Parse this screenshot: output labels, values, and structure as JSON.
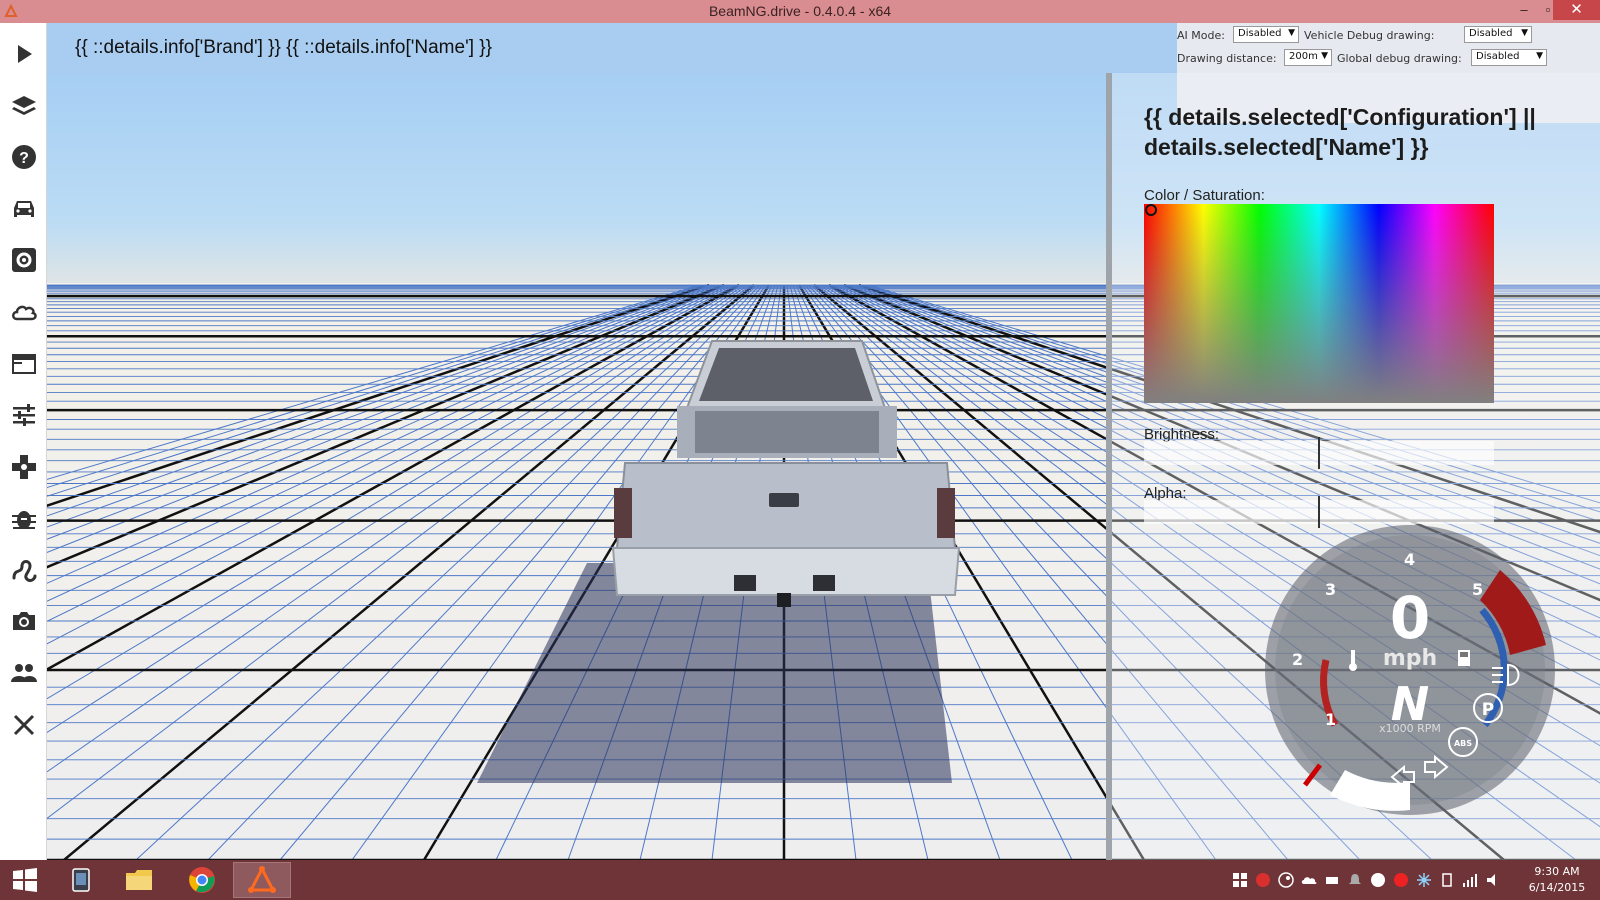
{
  "window": {
    "title": "BeamNG.drive - 0.4.0.4 - x64",
    "controls": {
      "minimize": "–",
      "maximize": "▫",
      "close": "✕"
    }
  },
  "sidebar": {
    "items": [
      {
        "name": "play",
        "icon": "play-icon"
      },
      {
        "name": "levels",
        "icon": "layers-icon"
      },
      {
        "name": "help",
        "icon": "help-icon"
      },
      {
        "name": "vehicles",
        "icon": "car-icon"
      },
      {
        "name": "vehicle-config",
        "icon": "gear-box-icon"
      },
      {
        "name": "environment",
        "icon": "cloud-icon"
      },
      {
        "name": "apps",
        "icon": "window-icon"
      },
      {
        "name": "options",
        "icon": "sliders-icon"
      },
      {
        "name": "controls",
        "icon": "gamepad-icon"
      },
      {
        "name": "debug",
        "icon": "bug-icon"
      },
      {
        "name": "track-builder",
        "icon": "path-icon"
      },
      {
        "name": "photo-mode",
        "icon": "camera-icon"
      },
      {
        "name": "multiplayer",
        "icon": "people-icon"
      },
      {
        "name": "exit",
        "icon": "close-icon"
      }
    ]
  },
  "infobar": {
    "vehicle_name": "{{ ::details.info['Brand'] }} {{ ::details.info['Name'] }}"
  },
  "debug": {
    "ai_mode_label": "AI Mode:",
    "ai_mode_value": "Disabled",
    "vehicle_debug_label": "Vehicle Debug drawing:",
    "vehicle_debug_value": "Disabled",
    "drawing_distance_label": "Drawing distance:",
    "drawing_distance_value": "200m",
    "global_debug_label": "Global debug drawing:",
    "global_debug_value": "Disabled"
  },
  "panel": {
    "title": "{{ details.selected['Configuration'] || details.selected['Name'] }}",
    "color_label": "Color / Saturation:",
    "brightness_label": "Brightness:",
    "alpha_label": "Alpha:"
  },
  "gauge": {
    "speed": "0",
    "speed_unit": "mph",
    "gear": "N",
    "rpm_label": "x1000 RPM",
    "ticks": [
      "1",
      "2",
      "3",
      "4",
      "5"
    ],
    "abs_label": "ABS",
    "parking_label": "P",
    "colors": {
      "redline": "#a11a1a",
      "fuel_arc": "#2f5fb0",
      "temp_arc": "#b32121"
    }
  },
  "taskbar": {
    "apps": [
      "tablet-icon",
      "file-explorer-icon",
      "chrome-icon",
      "beamng-icon"
    ],
    "time": "9:30 AM",
    "date": "6/14/2015"
  }
}
